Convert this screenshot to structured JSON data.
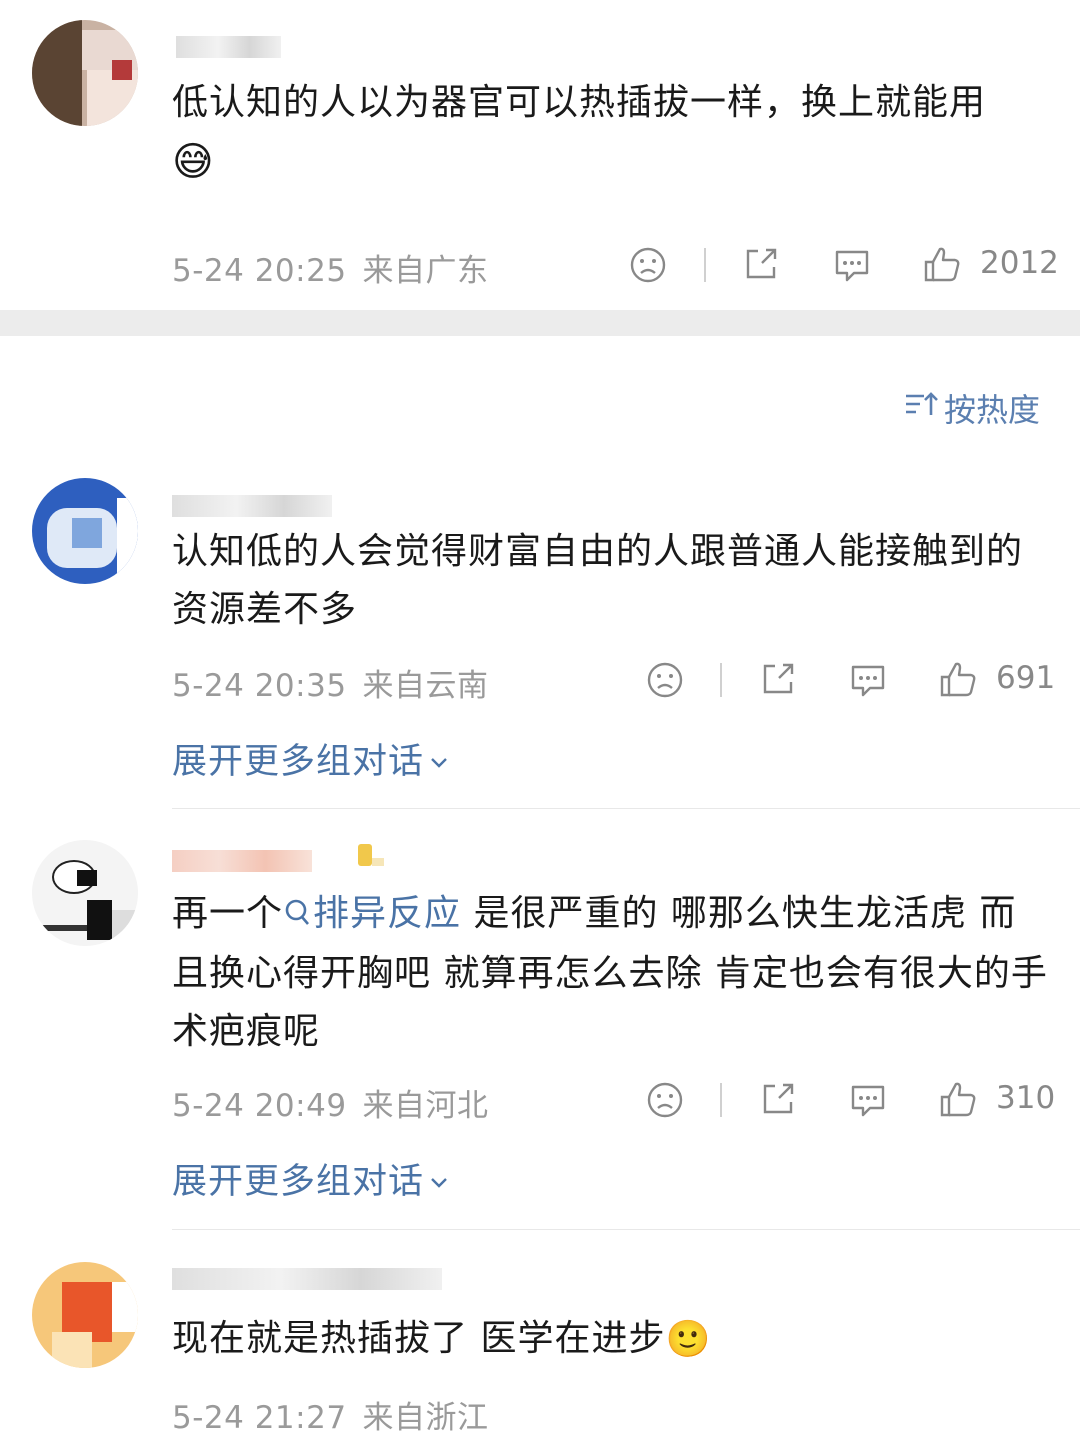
{
  "top_comment": {
    "text": "低认知的人以为器官可以热插拔一样，换上就能用",
    "emoji": "😅",
    "time": "5-24 20:25",
    "location": "来自广东",
    "likes": "2012"
  },
  "sort_label": "按热度",
  "comments": [
    {
      "text": "认知低的人会觉得财富自由的人跟普通人能接触到的资源差不多",
      "time": "5-24 20:35",
      "location": "来自云南",
      "likes": "691",
      "expand": "展开更多组对话"
    },
    {
      "text_link": "排异反应",
      "text_prefix": "再一个",
      "text_suffix": " 是很严重的 哪那么快生龙活虎 而且换心得开胸吧 就算再怎么去除 肯定也会有很大的手术疤痕呢",
      "time": "5-24 20:49",
      "location": "来自河北",
      "likes": "310",
      "expand": "展开更多组对话"
    },
    {
      "text": "现在就是热插拔了 医学在进步",
      "emoji": "🙂",
      "time": "5-24 21:27",
      "location": "来自浙江"
    }
  ],
  "colors": {
    "link": "#4a73a6",
    "meta": "#9a9a9a",
    "separator_band": "#ececec"
  },
  "icons": [
    "sad-face-icon",
    "share-icon",
    "comment-icon",
    "thumbs-up-icon",
    "sort-icon",
    "chevron-down-icon",
    "search-icon"
  ]
}
